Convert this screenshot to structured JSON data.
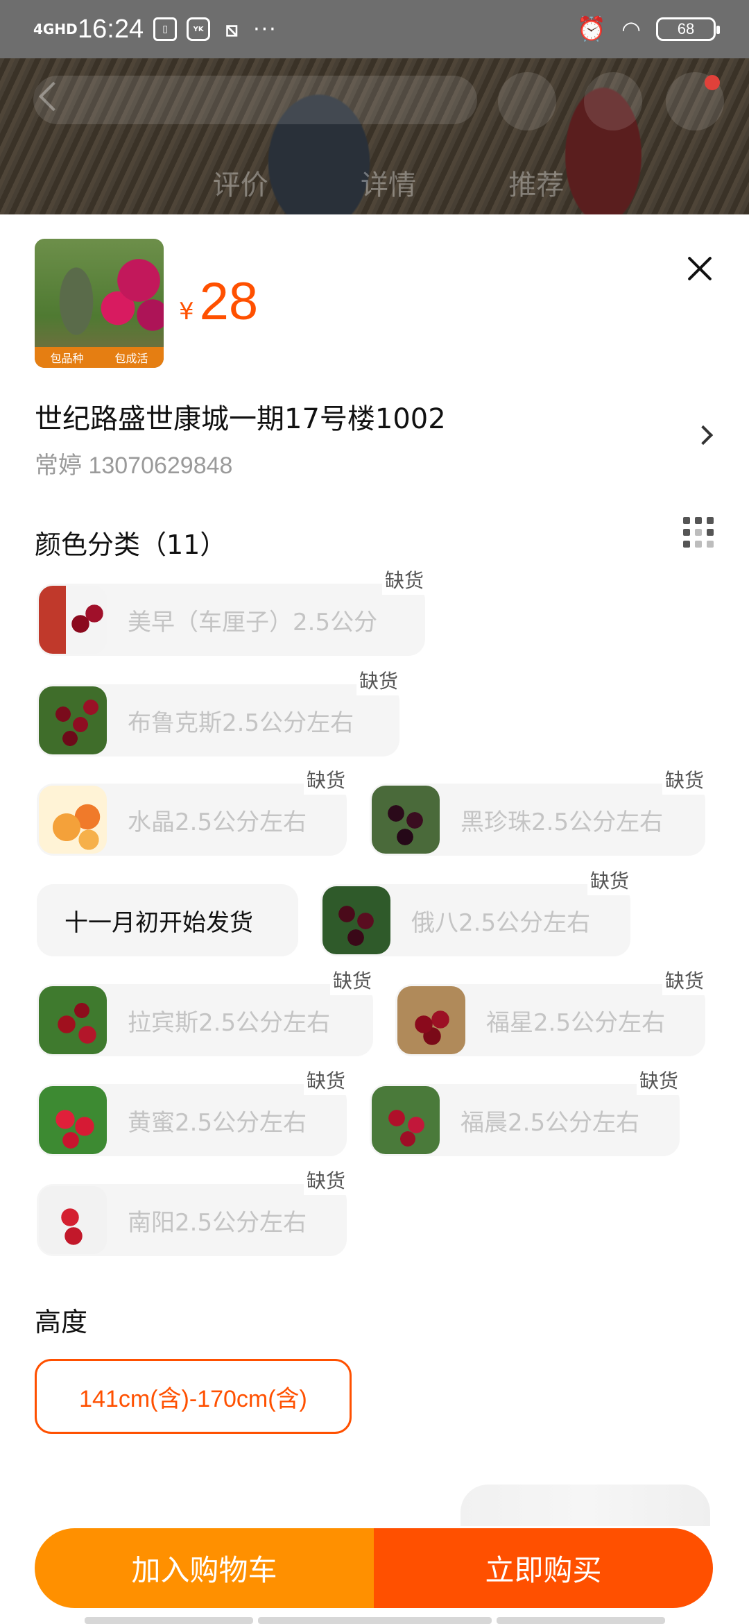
{
  "status_bar": {
    "network": "4GHD",
    "time": "16:24",
    "app_icons": [
      "sim-icon",
      "youku-icon",
      "screenshot-icon"
    ],
    "more": "···",
    "battery": "68"
  },
  "product": {
    "currency": "¥",
    "price": "28",
    "thumb_caption": [
      "包品种",
      "包成活"
    ]
  },
  "address": {
    "line": "世纪路盛世康城一期17号楼1002",
    "contact": "常婷 13070629848"
  },
  "color_section": {
    "title": "颜色分类（11）",
    "options": [
      {
        "label": "美早（车厘子）2.5公分",
        "badge": "缺货",
        "available": false
      },
      {
        "label": "布鲁克斯2.5公分左右",
        "badge": "缺货",
        "available": false
      },
      {
        "label": "水晶2.5公分左右",
        "badge": "缺货",
        "available": false
      },
      {
        "label": "黑珍珠2.5公分左右",
        "badge": "缺货",
        "available": false
      },
      {
        "label": "十一月初开始发货",
        "badge": "",
        "available": true
      },
      {
        "label": "俄八2.5公分左右",
        "badge": "缺货",
        "available": false
      },
      {
        "label": "拉宾斯2.5公分左右",
        "badge": "缺货",
        "available": false
      },
      {
        "label": "福星2.5公分左右",
        "badge": "缺货",
        "available": false
      },
      {
        "label": "黄蜜2.5公分左右",
        "badge": "缺货",
        "available": false
      },
      {
        "label": "福晨2.5公分左右",
        "badge": "缺货",
        "available": false
      },
      {
        "label": "南阳2.5公分左右",
        "badge": "缺货",
        "available": false
      }
    ]
  },
  "height_section": {
    "title": "高度",
    "selected": "141cm(含)-170cm(含)"
  },
  "actions": {
    "add_to_cart": "加入购物车",
    "buy_now": "立即购买"
  },
  "background": {
    "tabs": [
      "评价",
      "详情",
      "推荐"
    ]
  },
  "colors": {
    "accent": "#ff5000",
    "cart_button": "#ff9000",
    "option_bg": "#f5f5f5",
    "disabled_text": "#c4c4c4"
  }
}
